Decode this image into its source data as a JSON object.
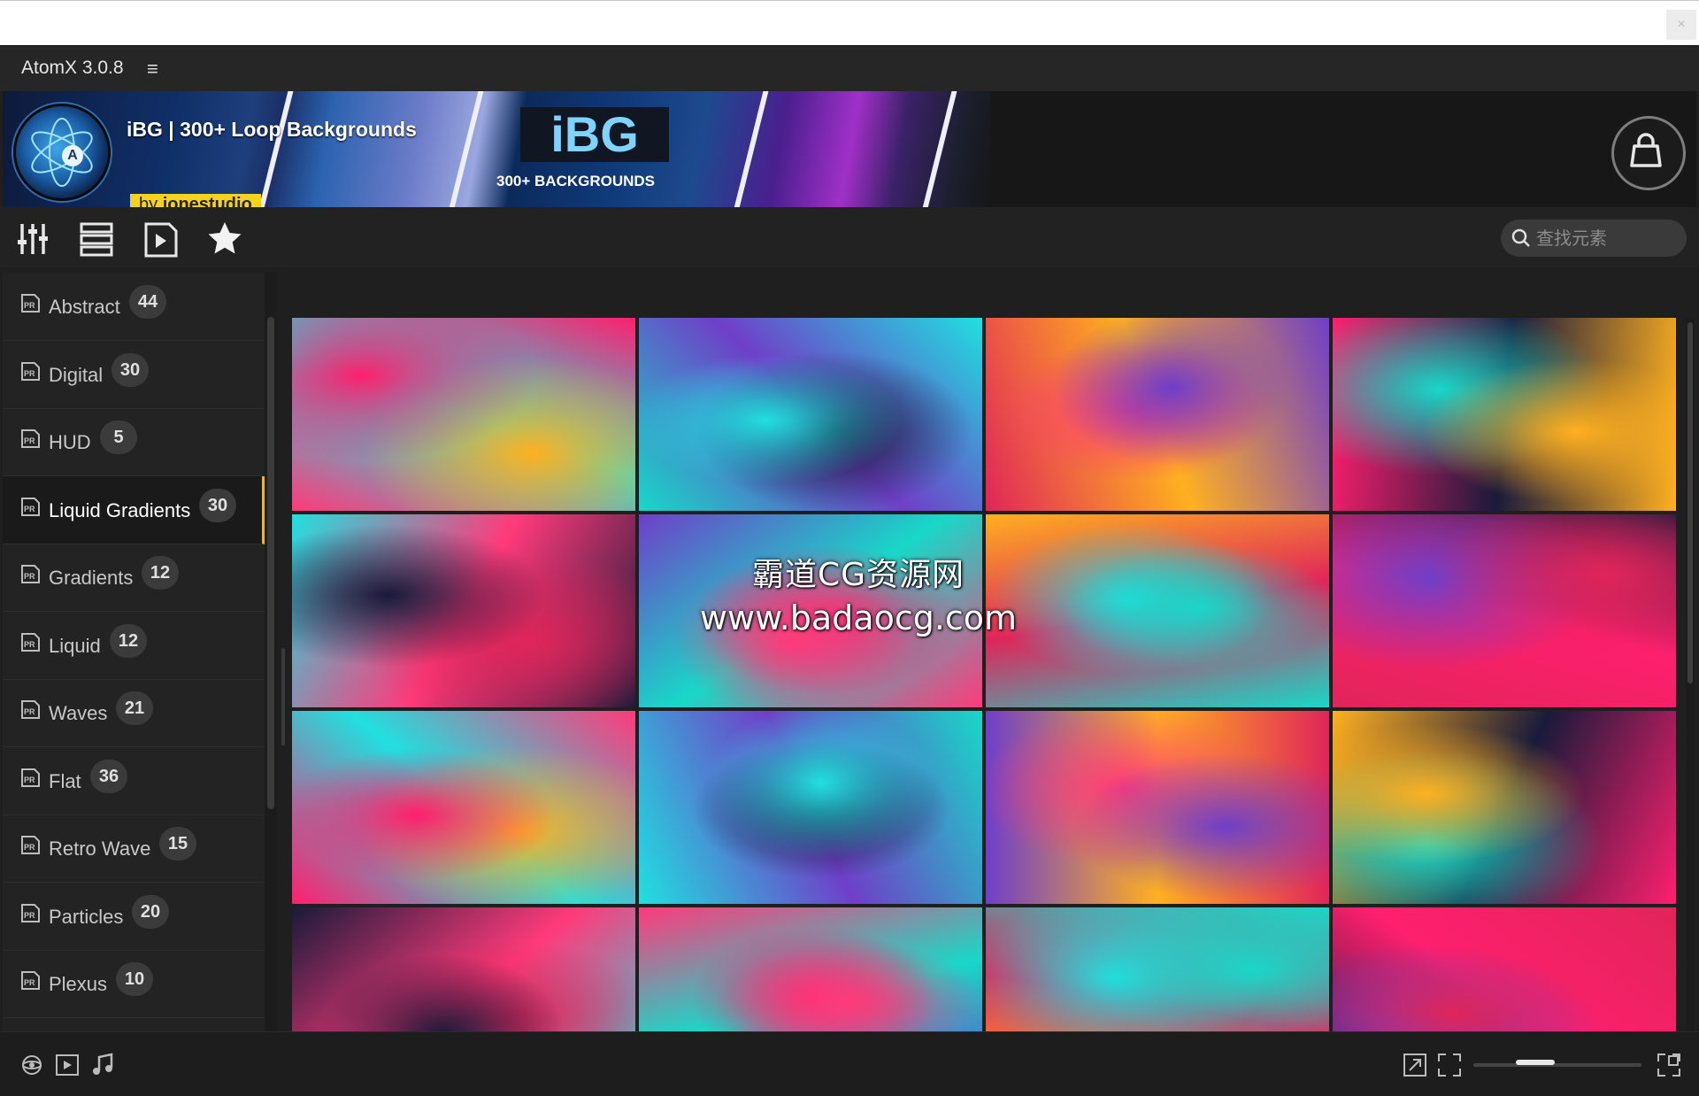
{
  "window": {
    "close_label": "×"
  },
  "app": {
    "title": "AtomX 3.0.8",
    "menu_icon": "menu-icon"
  },
  "banner": {
    "title": "iBG | 300+ Loop Backgrounds",
    "by_prefix": "by",
    "by_author": "ionestudio",
    "product_logo": "iBG",
    "product_subtitle": "300+ BACKGROUNDS",
    "accent_color": "#f5d21b"
  },
  "toolbar": {
    "icons": [
      "sliders-icon",
      "list-icon",
      "play-file-icon",
      "star-icon"
    ],
    "search_placeholder": "查找元素"
  },
  "sidebar": {
    "accent_color": "#e6b34a",
    "items": [
      {
        "label": "Abstract",
        "count": "44",
        "active": false
      },
      {
        "label": "Digital",
        "count": "30",
        "active": false
      },
      {
        "label": "HUD",
        "count": "5",
        "active": false
      },
      {
        "label": "Liquid Gradients",
        "count": "30",
        "active": true
      },
      {
        "label": "Gradients",
        "count": "12",
        "active": false
      },
      {
        "label": "Liquid",
        "count": "12",
        "active": false
      },
      {
        "label": "Waves",
        "count": "21",
        "active": false
      },
      {
        "label": "Flat",
        "count": "36",
        "active": false
      },
      {
        "label": "Retro Wave",
        "count": "15",
        "active": false
      },
      {
        "label": "Particles",
        "count": "20",
        "active": false
      },
      {
        "label": "Plexus",
        "count": "10",
        "active": false
      }
    ]
  },
  "thumbnails": {
    "palette": [
      "#ff1f6e",
      "#20e0e0",
      "#6f3fc8",
      "#ffb020",
      "#1a1a3a",
      "#ff3a7a",
      "#18d8c8",
      "#e0255a"
    ],
    "rows": 4,
    "cols": 4
  },
  "watermark": {
    "line1": "霸道CG资源网",
    "line2": "www.badaocg.com"
  },
  "bottom": {
    "left_icons": [
      "3d-object-icon",
      "video-icon",
      "music-icon"
    ],
    "right_icons": [
      "expand-icon",
      "fit-icon",
      "grid-size-icon"
    ],
    "zoom_level": 0.33
  }
}
